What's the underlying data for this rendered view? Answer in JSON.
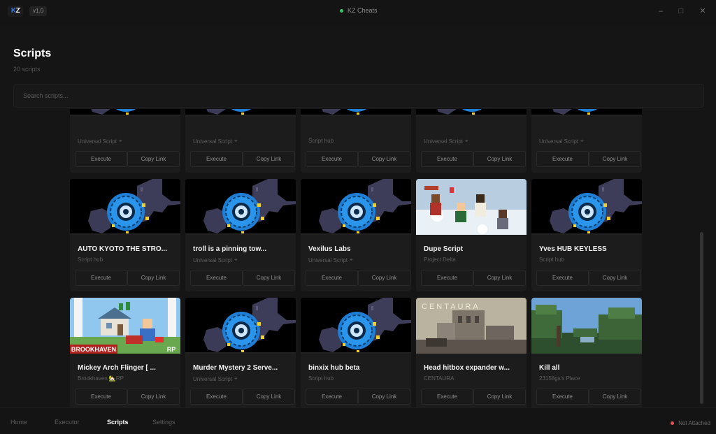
{
  "titlebar": {
    "logo": "KZ",
    "version": "v1.0",
    "app_title": "KZ Cheats",
    "minimize_icon": "minimize-icon",
    "maximize_icon": "maximize-icon",
    "close_icon": "close-icon"
  },
  "header": {
    "title": "Scripts",
    "count": "20 scripts"
  },
  "search": {
    "placeholder": "Search scripts..."
  },
  "buttons": {
    "execute": "Execute",
    "copy": "Copy Link"
  },
  "cards": [
    {
      "title": "",
      "subtitle": "Universal Script",
      "pinned": true,
      "thumb": "logo"
    },
    {
      "title": "",
      "subtitle": "Universal Script",
      "pinned": true,
      "thumb": "logo"
    },
    {
      "title": "",
      "subtitle": "Script hub",
      "pinned": false,
      "thumb": "logo"
    },
    {
      "title": "",
      "subtitle": "Universal Script",
      "pinned": true,
      "thumb": "logo"
    },
    {
      "title": "",
      "subtitle": "Universal Script",
      "pinned": true,
      "thumb": "logo"
    },
    {
      "title": "AUTO KYOTO  THE STRO...",
      "subtitle": "Script hub",
      "pinned": false,
      "thumb": "logo"
    },
    {
      "title": "troll is a pinning tow...",
      "subtitle": "Universal Script",
      "pinned": true,
      "thumb": "logo"
    },
    {
      "title": "Vexilus Labs",
      "subtitle": "Universal Script",
      "pinned": true,
      "thumb": "logo"
    },
    {
      "title": "Dupe Script",
      "subtitle": "Project Delta",
      "pinned": false,
      "thumb": "snow"
    },
    {
      "title": "Yves HUB KEYLESS",
      "subtitle": "Script hub",
      "pinned": false,
      "thumb": "logo"
    },
    {
      "title": "Mickey Arch Flinger [ ...",
      "subtitle": "Brookhaven 🏡RP",
      "pinned": false,
      "thumb": "brookhaven",
      "thumb_label": "BROOKHAVEN",
      "thumb_badge": "RP"
    },
    {
      "title": "Murder Mystery 2 Serve...",
      "subtitle": "Universal Script",
      "pinned": true,
      "thumb": "logo"
    },
    {
      "title": "binxix hub beta",
      "subtitle": "Script hub",
      "pinned": false,
      "thumb": "logo"
    },
    {
      "title": "Head hitbox expander w...",
      "subtitle": "CENTAURA",
      "pinned": false,
      "thumb": "centaura",
      "thumb_label": "CENTAURA"
    },
    {
      "title": "Kill all",
      "subtitle": "23158gs's Place",
      "pinned": false,
      "thumb": "forest"
    }
  ],
  "nav": [
    {
      "label": "Home",
      "active": false
    },
    {
      "label": "Executor",
      "active": false
    },
    {
      "label": "Scripts",
      "active": true
    },
    {
      "label": "Settings",
      "active": false
    }
  ],
  "status": {
    "label": "Not Attached",
    "color": "#e85050"
  },
  "colors": {
    "accent": "#2b7bff",
    "connected": "#3ec16a"
  }
}
